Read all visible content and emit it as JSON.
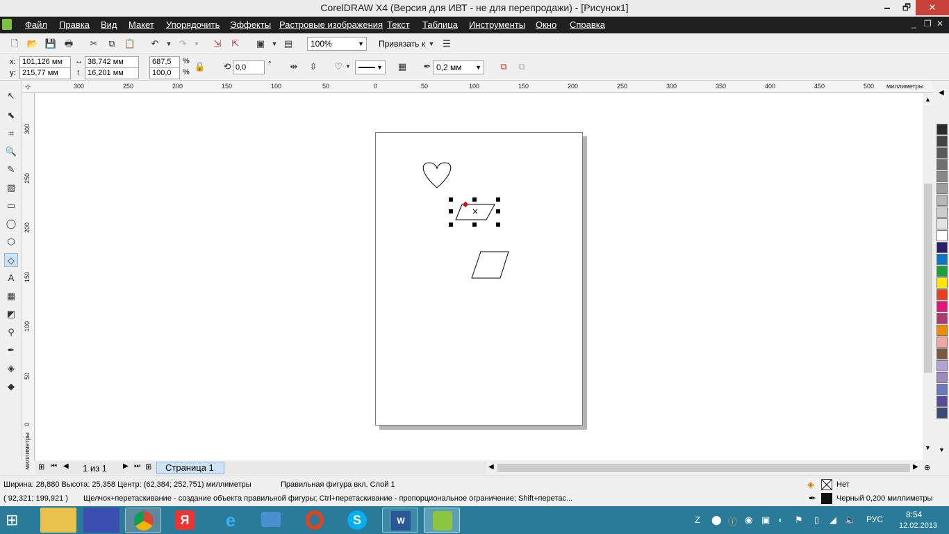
{
  "window": {
    "title": "CorelDRAW X4 (Версия для ИВТ - не для перепродажи) - [Рисунок1]",
    "minimize": "🗕",
    "maximize": "🗗",
    "close": "✕"
  },
  "menu": [
    "Файл",
    "Правка",
    "Вид",
    "Макет",
    "Упорядочить",
    "Эффекты",
    "Растровые изображения",
    "Текст",
    "Таблица",
    "Инструменты",
    "Окно",
    "Справка"
  ],
  "doc_controls": {
    "min": "_",
    "restore": "❐",
    "close": "✕"
  },
  "toolbar_standard": {
    "zoom": "100%",
    "snap_label": "Привязать к"
  },
  "property_bar": {
    "x_label": "x:",
    "x": "101,126 мм",
    "y_label": "y:",
    "y": "215,77 мм",
    "width": "38,742 мм",
    "height": "16,201 мм",
    "scale_x": "687,5",
    "scale_y": "100,0",
    "percent": "%",
    "rotation": "0,0",
    "degree": "°",
    "outline_width": "0,2 мм"
  },
  "ruler": {
    "units": "миллиметры",
    "top_ticks": [
      "300",
      "250",
      "200",
      "150",
      "100",
      "50",
      "0",
      "50",
      "100",
      "150",
      "200",
      "250",
      "300",
      "350",
      "400",
      "450",
      "500"
    ],
    "left_ticks": [
      "300",
      "250",
      "200",
      "150",
      "100",
      "50",
      "0"
    ],
    "left_units": "миллиметры"
  },
  "page_nav": {
    "counter": "1 из 1",
    "tab": "Страница 1"
  },
  "status": {
    "dims": "Ширина: 28,880  Высота: 25,358  Центр: (62,384; 252,751)  миллиметры",
    "object": "Правильная фигура вкл. Слой 1",
    "fill": "Нет",
    "coords": "( 92,321; 199,921 )",
    "hint": "Щелчок+перетаскивание - создание объекта правильной фигуры; Ctrl+перетаскивание - пропорциональное ограничение; Shift+перетас...",
    "outline": "Черный  0,200 миллиметры"
  },
  "palette": [
    "#2b2b2b",
    "#444444",
    "#5a5a5a",
    "#707070",
    "#888888",
    "#9e9e9e",
    "#b5b5b5",
    "#cccccc",
    "#e3e3e3",
    "#ffffff",
    "#2e1a6e",
    "#0a77c8",
    "#17a33a",
    "#ffe500",
    "#e8401c",
    "#e2157a",
    "#b03a6e",
    "#f08a00",
    "#f5a3a3",
    "#7a5a3a",
    "#b5a3d3",
    "#9a8ac0",
    "#6a7ac0",
    "#5a4a9a",
    "#3a4a7a"
  ],
  "colors": {
    "accent": "#2a7a99",
    "menubar": "#1f1f1f",
    "close": "#c7413a"
  },
  "taskbar": {
    "lang": "РУС",
    "time": "8:54",
    "date": "12.02.2013"
  }
}
